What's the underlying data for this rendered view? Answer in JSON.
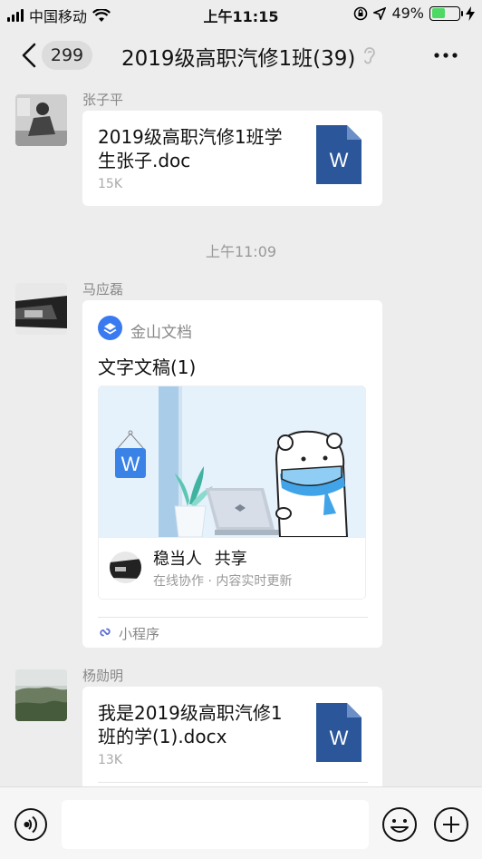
{
  "status_bar": {
    "carrier": "中国移动",
    "time": "上午11:15",
    "battery_percent": "49%",
    "battery_level": 0.49
  },
  "nav": {
    "unread_count": "299",
    "title": "2019级高职汽修1班(39)"
  },
  "messages": [
    {
      "sender": "张子平",
      "file_line1": "2019级高职汽修1班学",
      "file_line2": "生张子.doc",
      "size": "15K",
      "icon_letter": "W"
    },
    {
      "sender": "马应磊",
      "app_name": "金山文档",
      "doc_title": "文字文稿(1)",
      "share_user": "稳当人",
      "share_action": "共享",
      "share_desc": "在线协作 · 内容实时更新",
      "mini_program_label": "小程序",
      "thumb_icon_letter": "W"
    },
    {
      "sender": "杨勋明",
      "file_line1": "我是2019级高职汽修1",
      "file_line2": "班的学(1).docx",
      "size": "13K",
      "icon_letter": "W"
    }
  ],
  "time_separator": "上午11:09",
  "colors": {
    "background": "#ededed",
    "word_blue": "#2b579a",
    "battery_green": "#4cd964",
    "wps_blue": "#3a7af0"
  }
}
